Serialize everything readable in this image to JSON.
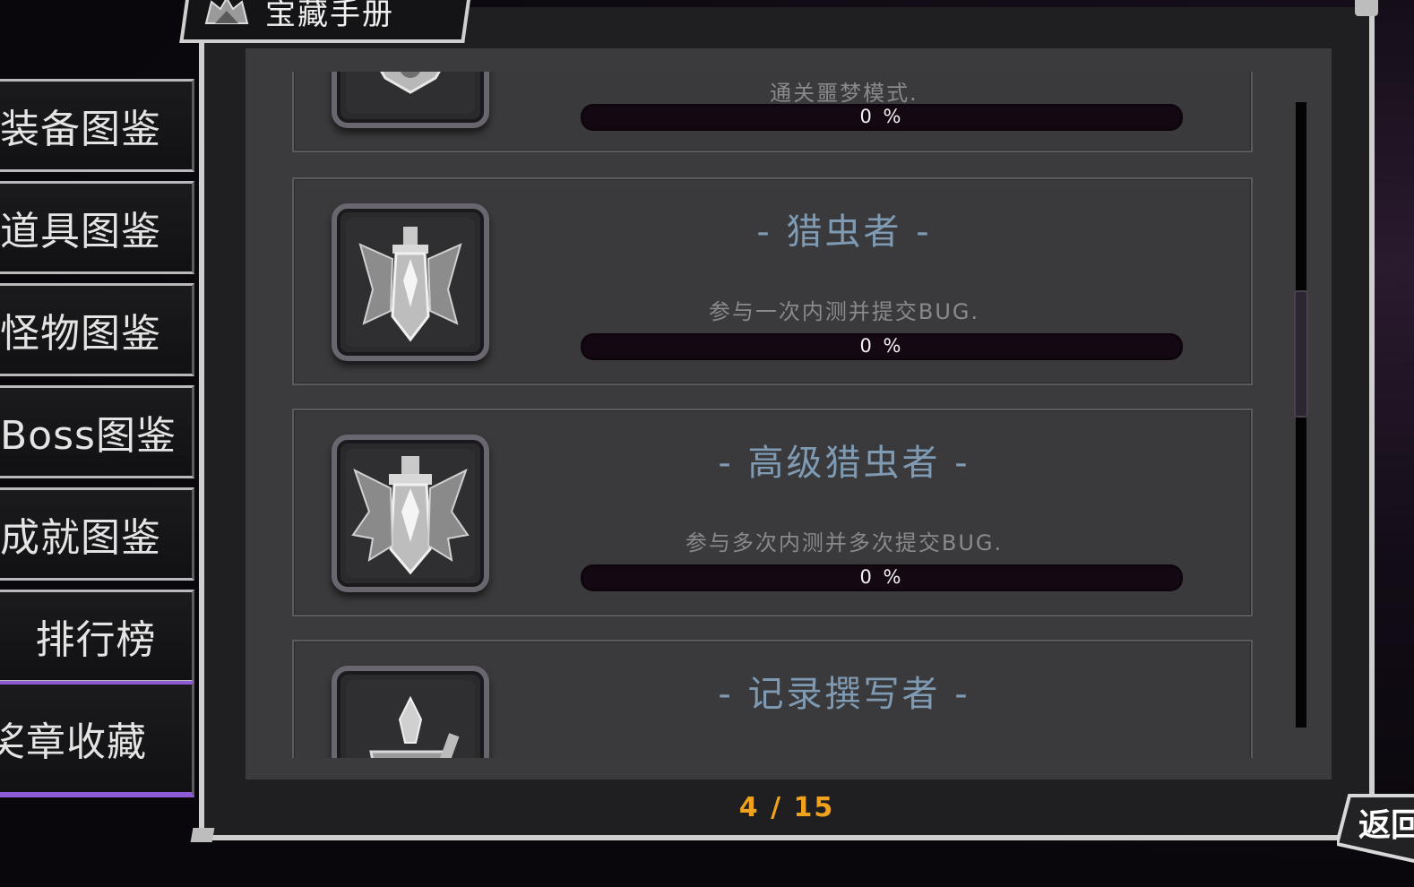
{
  "title": "宝藏手册",
  "sidebar": {
    "items": [
      {
        "label": "装备图鉴"
      },
      {
        "label": "道具图鉴"
      },
      {
        "label": "怪物图鉴"
      },
      {
        "label": "Boss图鉴"
      },
      {
        "label": "成就图鉴"
      },
      {
        "label": "排行榜"
      },
      {
        "label": "奖章收藏"
      }
    ]
  },
  "cards": [
    {
      "title": "",
      "desc": "通关噩梦模式.",
      "progress": "0 %",
      "progress_value": 0,
      "icon": "lotus-emblem-icon"
    },
    {
      "title": "- 猎虫者 -",
      "desc": "参与一次内测并提交BUG.",
      "progress": "0 %",
      "progress_value": 0,
      "icon": "bug-hunter-emblem-icon"
    },
    {
      "title": "- 高级猎虫者 -",
      "desc": "参与多次内测并多次提交BUG.",
      "progress": "0 %",
      "progress_value": 0,
      "icon": "senior-bug-hunter-emblem-icon"
    },
    {
      "title": "- 记录撰写者 -",
      "desc": "",
      "progress": "",
      "progress_value": 0,
      "icon": "quill-shield-emblem-icon"
    }
  ],
  "pagination": {
    "text": "4 / 15"
  },
  "back_button": {
    "label": "返回"
  },
  "colors": {
    "accent_purple": "#8e5ad8",
    "page_indicator": "#f0a21c",
    "card_title": "#7f9ab3"
  }
}
